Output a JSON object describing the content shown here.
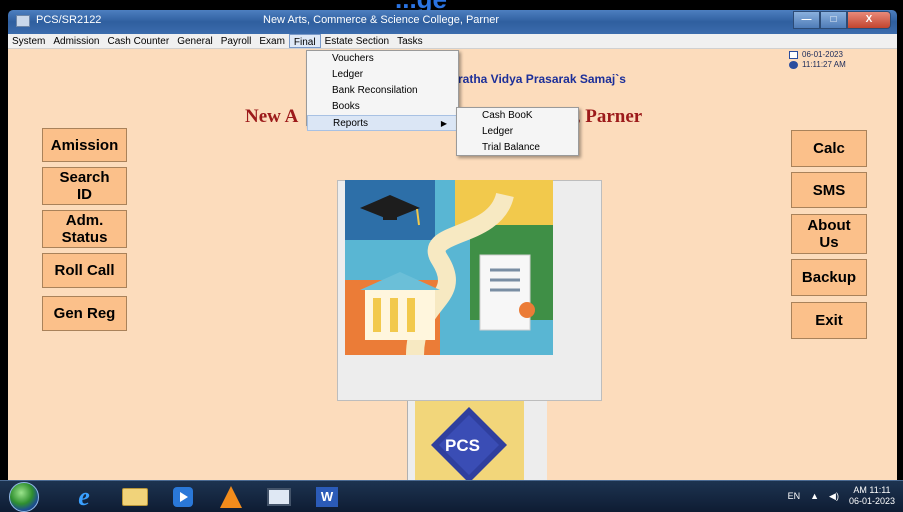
{
  "window": {
    "app_title": "PCS/SR2122",
    "caption": "New Arts, Commerce & Science College, Parner",
    "buttons": [
      "—",
      "□",
      "X"
    ]
  },
  "menubar": [
    "System",
    "Admission",
    "Cash Counter",
    "General",
    "Payroll",
    "Exam",
    "Final",
    "Estate Section",
    "Tasks"
  ],
  "final_menu": {
    "items": [
      "Vouchers",
      "Ledger",
      "Bank Reconsilation",
      "Books",
      "Reports"
    ]
  },
  "reports_submenu": {
    "items": [
      "Cash BooK",
      "Ledger",
      "Trial Balance"
    ]
  },
  "header": {
    "society_partial": "ratha Vidya Prasarak Samaj`s",
    "college_left": "New A",
    "college_right": "ollege, Parner"
  },
  "datetime": {
    "date": "06-01-2023",
    "time": "11:11:27 AM"
  },
  "left_buttons": [
    "Amission",
    "Search\nID",
    "Adm.\nStatus",
    "Roll Call",
    "Gen Reg"
  ],
  "right_buttons": [
    "Calc",
    "SMS",
    "About\nUs",
    "Backup",
    "Exit"
  ],
  "logo_text": "PCS",
  "taskbar": {
    "lang": "EN",
    "clock_time": "AM 11:11",
    "clock_date": "06-01-2023",
    "icons": [
      "windows-start-icon",
      "internet-explorer-icon",
      "file-explorer-icon",
      "media-player-icon",
      "vlc-icon",
      "window-icon",
      "word-icon"
    ]
  },
  "colors": {
    "background": "#fcdcbc",
    "button": "#fbc08a",
    "title_red": "#9c1a1a",
    "society_blue": "#1c2f99"
  }
}
